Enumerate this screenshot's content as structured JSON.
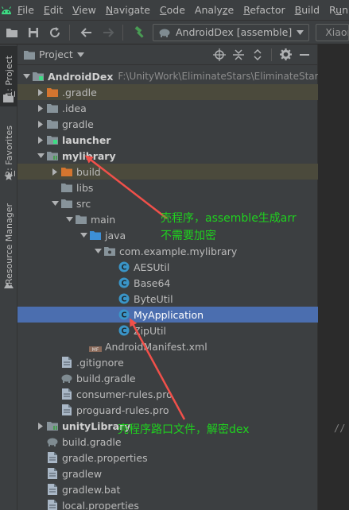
{
  "menu": {
    "items": [
      {
        "pre": "",
        "mn": "F",
        "post": "ile"
      },
      {
        "pre": "",
        "mn": "E",
        "post": "dit"
      },
      {
        "pre": "",
        "mn": "V",
        "post": "iew"
      },
      {
        "pre": "",
        "mn": "N",
        "post": "avigate"
      },
      {
        "pre": "",
        "mn": "C",
        "post": "ode"
      },
      {
        "pre": "Analy",
        "mn": "z",
        "post": "e"
      },
      {
        "pre": "",
        "mn": "R",
        "post": "efactor"
      },
      {
        "pre": "",
        "mn": "B",
        "post": "uild"
      },
      {
        "pre": "R",
        "mn": "u",
        "post": "n"
      }
    ]
  },
  "toolbar": {
    "run_config": "AndroidDex [assemble]",
    "device": "Xiaomi"
  },
  "left_strip": {
    "project": {
      "mn": "1",
      "rest": ": Project"
    },
    "favorites": {
      "mn": "2",
      "rest": ": Favorites"
    },
    "resource_manager": "Resource Manager"
  },
  "panel": {
    "title": "Project"
  },
  "tree": [
    {
      "label": "AndroidDex",
      "bold": true,
      "indent": 0,
      "arrow": "down",
      "icon": "module",
      "path": "F:\\UnityWork\\EliminateStars\\EliminateStars\\Bu"
    },
    {
      "label": ".gradle",
      "indent": 1,
      "arrow": "right",
      "icon": "folder-orange",
      "hl": true
    },
    {
      "label": ".idea",
      "indent": 1,
      "arrow": "right",
      "icon": "folder-gray"
    },
    {
      "label": "gradle",
      "indent": 1,
      "arrow": "right",
      "icon": "folder-gray"
    },
    {
      "label": "launcher",
      "bold": true,
      "indent": 1,
      "arrow": "right",
      "icon": "module"
    },
    {
      "label": "mylibrary",
      "bold": true,
      "indent": 1,
      "arrow": "down",
      "icon": "module-lib"
    },
    {
      "label": "build",
      "indent": 2,
      "arrow": "right",
      "icon": "folder-orange",
      "hl": true
    },
    {
      "label": "libs",
      "indent": 2,
      "arrow": "none",
      "icon": "folder-gray"
    },
    {
      "label": "src",
      "indent": 2,
      "arrow": "down",
      "icon": "folder-gray"
    },
    {
      "label": "main",
      "indent": 3,
      "arrow": "down",
      "icon": "folder-gray"
    },
    {
      "label": "java",
      "indent": 4,
      "arrow": "down",
      "icon": "folder-blue"
    },
    {
      "label": "com.example.mylibrary",
      "indent": 5,
      "arrow": "down",
      "icon": "package"
    },
    {
      "label": "AESUtil",
      "indent": 6,
      "arrow": "none",
      "icon": "class"
    },
    {
      "label": "Base64",
      "indent": 6,
      "arrow": "none",
      "icon": "class"
    },
    {
      "label": "ByteUtil",
      "indent": 6,
      "arrow": "none",
      "icon": "class"
    },
    {
      "label": "MyApplication",
      "indent": 6,
      "arrow": "none",
      "icon": "class",
      "sel": true
    },
    {
      "label": "ZipUtil",
      "indent": 6,
      "arrow": "none",
      "icon": "class"
    },
    {
      "label": "AndroidManifest.xml",
      "indent": 4,
      "arrow": "none",
      "icon": "manifest"
    },
    {
      "label": ".gitignore",
      "indent": 2,
      "arrow": "none",
      "icon": "file"
    },
    {
      "label": "build.gradle",
      "indent": 2,
      "arrow": "none",
      "icon": "gradle"
    },
    {
      "label": "consumer-rules.pro",
      "indent": 2,
      "arrow": "none",
      "icon": "file"
    },
    {
      "label": "proguard-rules.pro",
      "indent": 2,
      "arrow": "none",
      "icon": "file"
    },
    {
      "label": "unityLibrary",
      "bold": true,
      "indent": 1,
      "arrow": "right",
      "icon": "module-lib"
    },
    {
      "label": "build.gradle",
      "indent": 1,
      "arrow": "none",
      "icon": "gradle"
    },
    {
      "label": "gradle.properties",
      "indent": 1,
      "arrow": "none",
      "icon": "file"
    },
    {
      "label": "gradlew",
      "indent": 1,
      "arrow": "none",
      "icon": "file"
    },
    {
      "label": "gradlew.bat",
      "indent": 1,
      "arrow": "none",
      "icon": "file"
    },
    {
      "label": "local.properties",
      "indent": 1,
      "arrow": "none",
      "icon": "file"
    }
  ],
  "annotations": {
    "shell_line1": "壳程序，assemble生成arr",
    "shell_line2": "不需要加密",
    "entry": "壳程序路口文件，解密dex"
  },
  "editor": {
    "comment": "//"
  },
  "colors": {
    "annotation_text": "#1fd11f",
    "annotation_arrow": "#f0504a",
    "selection": "#4b6eaf"
  }
}
